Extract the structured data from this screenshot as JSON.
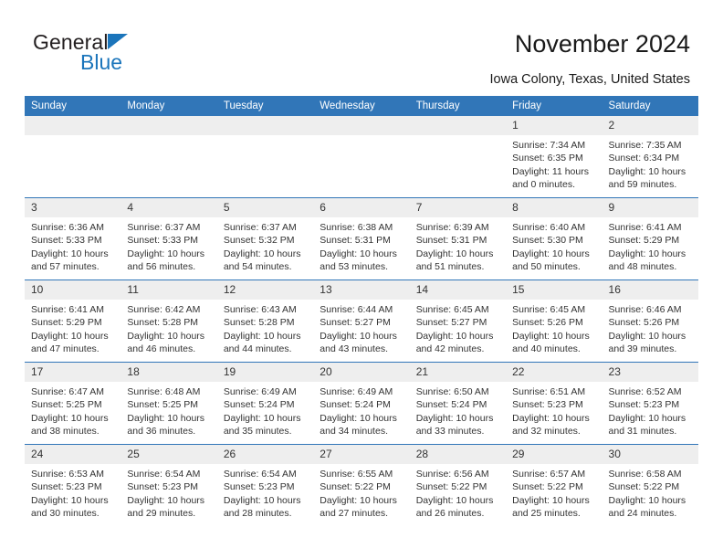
{
  "brand": {
    "name_top": "General",
    "name_bottom": "Blue"
  },
  "header": {
    "title": "November 2024",
    "subtitle": "Iowa Colony, Texas, United States"
  },
  "colors": {
    "header_blue": "#3176b8",
    "daynum_band": "#eeeeee",
    "brand_blue": "#1b75bb",
    "text": "#333333"
  },
  "weekdays": [
    "Sunday",
    "Monday",
    "Tuesday",
    "Wednesday",
    "Thursday",
    "Friday",
    "Saturday"
  ],
  "weeks": [
    [
      {
        "day": "",
        "empty": true
      },
      {
        "day": "",
        "empty": true
      },
      {
        "day": "",
        "empty": true
      },
      {
        "day": "",
        "empty": true
      },
      {
        "day": "",
        "empty": true
      },
      {
        "day": "1",
        "sunrise": "Sunrise: 7:34 AM",
        "sunset": "Sunset: 6:35 PM",
        "daylight1": "Daylight: 11 hours",
        "daylight2": "and 0 minutes."
      },
      {
        "day": "2",
        "sunrise": "Sunrise: 7:35 AM",
        "sunset": "Sunset: 6:34 PM",
        "daylight1": "Daylight: 10 hours",
        "daylight2": "and 59 minutes."
      }
    ],
    [
      {
        "day": "3",
        "sunrise": "Sunrise: 6:36 AM",
        "sunset": "Sunset: 5:33 PM",
        "daylight1": "Daylight: 10 hours",
        "daylight2": "and 57 minutes."
      },
      {
        "day": "4",
        "sunrise": "Sunrise: 6:37 AM",
        "sunset": "Sunset: 5:33 PM",
        "daylight1": "Daylight: 10 hours",
        "daylight2": "and 56 minutes."
      },
      {
        "day": "5",
        "sunrise": "Sunrise: 6:37 AM",
        "sunset": "Sunset: 5:32 PM",
        "daylight1": "Daylight: 10 hours",
        "daylight2": "and 54 minutes."
      },
      {
        "day": "6",
        "sunrise": "Sunrise: 6:38 AM",
        "sunset": "Sunset: 5:31 PM",
        "daylight1": "Daylight: 10 hours",
        "daylight2": "and 53 minutes."
      },
      {
        "day": "7",
        "sunrise": "Sunrise: 6:39 AM",
        "sunset": "Sunset: 5:31 PM",
        "daylight1": "Daylight: 10 hours",
        "daylight2": "and 51 minutes."
      },
      {
        "day": "8",
        "sunrise": "Sunrise: 6:40 AM",
        "sunset": "Sunset: 5:30 PM",
        "daylight1": "Daylight: 10 hours",
        "daylight2": "and 50 minutes."
      },
      {
        "day": "9",
        "sunrise": "Sunrise: 6:41 AM",
        "sunset": "Sunset: 5:29 PM",
        "daylight1": "Daylight: 10 hours",
        "daylight2": "and 48 minutes."
      }
    ],
    [
      {
        "day": "10",
        "sunrise": "Sunrise: 6:41 AM",
        "sunset": "Sunset: 5:29 PM",
        "daylight1": "Daylight: 10 hours",
        "daylight2": "and 47 minutes."
      },
      {
        "day": "11",
        "sunrise": "Sunrise: 6:42 AM",
        "sunset": "Sunset: 5:28 PM",
        "daylight1": "Daylight: 10 hours",
        "daylight2": "and 46 minutes."
      },
      {
        "day": "12",
        "sunrise": "Sunrise: 6:43 AM",
        "sunset": "Sunset: 5:28 PM",
        "daylight1": "Daylight: 10 hours",
        "daylight2": "and 44 minutes."
      },
      {
        "day": "13",
        "sunrise": "Sunrise: 6:44 AM",
        "sunset": "Sunset: 5:27 PM",
        "daylight1": "Daylight: 10 hours",
        "daylight2": "and 43 minutes."
      },
      {
        "day": "14",
        "sunrise": "Sunrise: 6:45 AM",
        "sunset": "Sunset: 5:27 PM",
        "daylight1": "Daylight: 10 hours",
        "daylight2": "and 42 minutes."
      },
      {
        "day": "15",
        "sunrise": "Sunrise: 6:45 AM",
        "sunset": "Sunset: 5:26 PM",
        "daylight1": "Daylight: 10 hours",
        "daylight2": "and 40 minutes."
      },
      {
        "day": "16",
        "sunrise": "Sunrise: 6:46 AM",
        "sunset": "Sunset: 5:26 PM",
        "daylight1": "Daylight: 10 hours",
        "daylight2": "and 39 minutes."
      }
    ],
    [
      {
        "day": "17",
        "sunrise": "Sunrise: 6:47 AM",
        "sunset": "Sunset: 5:25 PM",
        "daylight1": "Daylight: 10 hours",
        "daylight2": "and 38 minutes."
      },
      {
        "day": "18",
        "sunrise": "Sunrise: 6:48 AM",
        "sunset": "Sunset: 5:25 PM",
        "daylight1": "Daylight: 10 hours",
        "daylight2": "and 36 minutes."
      },
      {
        "day": "19",
        "sunrise": "Sunrise: 6:49 AM",
        "sunset": "Sunset: 5:24 PM",
        "daylight1": "Daylight: 10 hours",
        "daylight2": "and 35 minutes."
      },
      {
        "day": "20",
        "sunrise": "Sunrise: 6:49 AM",
        "sunset": "Sunset: 5:24 PM",
        "daylight1": "Daylight: 10 hours",
        "daylight2": "and 34 minutes."
      },
      {
        "day": "21",
        "sunrise": "Sunrise: 6:50 AM",
        "sunset": "Sunset: 5:24 PM",
        "daylight1": "Daylight: 10 hours",
        "daylight2": "and 33 minutes."
      },
      {
        "day": "22",
        "sunrise": "Sunrise: 6:51 AM",
        "sunset": "Sunset: 5:23 PM",
        "daylight1": "Daylight: 10 hours",
        "daylight2": "and 32 minutes."
      },
      {
        "day": "23",
        "sunrise": "Sunrise: 6:52 AM",
        "sunset": "Sunset: 5:23 PM",
        "daylight1": "Daylight: 10 hours",
        "daylight2": "and 31 minutes."
      }
    ],
    [
      {
        "day": "24",
        "sunrise": "Sunrise: 6:53 AM",
        "sunset": "Sunset: 5:23 PM",
        "daylight1": "Daylight: 10 hours",
        "daylight2": "and 30 minutes."
      },
      {
        "day": "25",
        "sunrise": "Sunrise: 6:54 AM",
        "sunset": "Sunset: 5:23 PM",
        "daylight1": "Daylight: 10 hours",
        "daylight2": "and 29 minutes."
      },
      {
        "day": "26",
        "sunrise": "Sunrise: 6:54 AM",
        "sunset": "Sunset: 5:23 PM",
        "daylight1": "Daylight: 10 hours",
        "daylight2": "and 28 minutes."
      },
      {
        "day": "27",
        "sunrise": "Sunrise: 6:55 AM",
        "sunset": "Sunset: 5:22 PM",
        "daylight1": "Daylight: 10 hours",
        "daylight2": "and 27 minutes."
      },
      {
        "day": "28",
        "sunrise": "Sunrise: 6:56 AM",
        "sunset": "Sunset: 5:22 PM",
        "daylight1": "Daylight: 10 hours",
        "daylight2": "and 26 minutes."
      },
      {
        "day": "29",
        "sunrise": "Sunrise: 6:57 AM",
        "sunset": "Sunset: 5:22 PM",
        "daylight1": "Daylight: 10 hours",
        "daylight2": "and 25 minutes."
      },
      {
        "day": "30",
        "sunrise": "Sunrise: 6:58 AM",
        "sunset": "Sunset: 5:22 PM",
        "daylight1": "Daylight: 10 hours",
        "daylight2": "and 24 minutes."
      }
    ]
  ]
}
